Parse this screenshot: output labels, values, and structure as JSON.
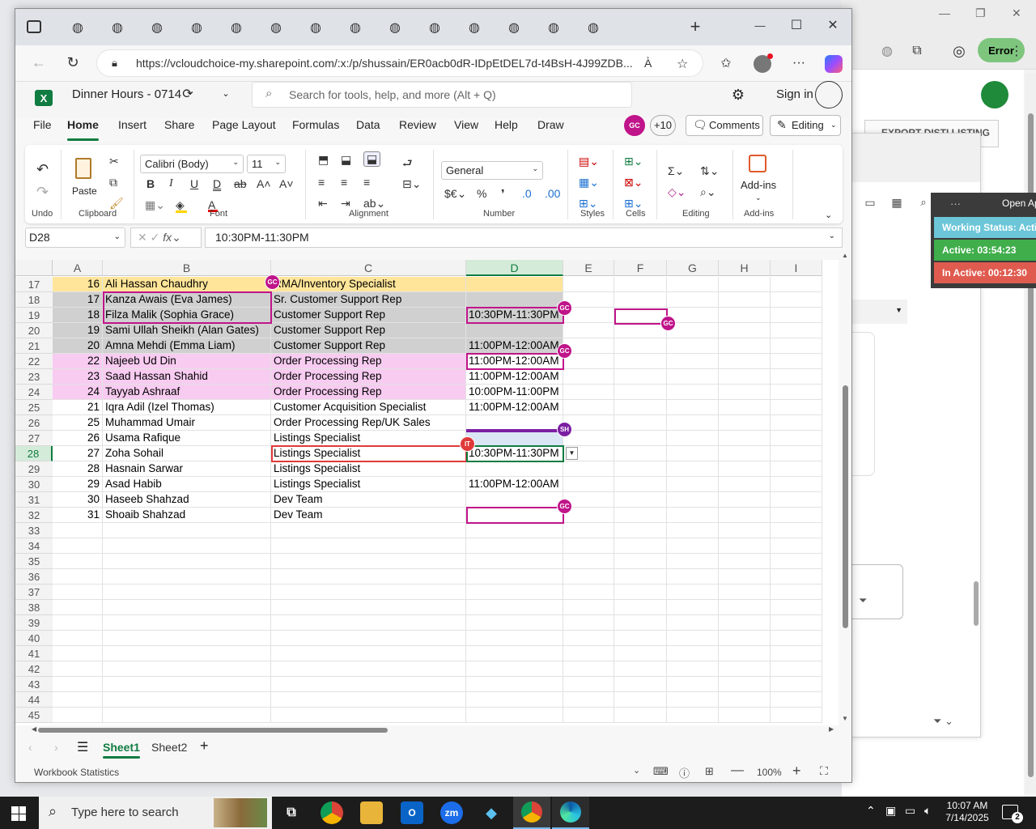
{
  "browser": {
    "url": "https://vcloudchoice-my.sharepoint.com/:x:/p/shussain/ER0acb0dR-IDpEtDEL7d-t4BsH-4J99ZDB...",
    "tab_count": 14
  },
  "bg": {
    "error_label": "Error",
    "export_label": "EXPORT DISTI LISTING",
    "status_header": "Open Ap",
    "working_status": "Working Status: Active",
    "active_time": "Active: 03:54:23",
    "inactive_time": "In Active: 00:12:30"
  },
  "excel": {
    "title": "Dinner Hours - 0714",
    "search_placeholder": "Search for tools, help, and more (Alt + Q)",
    "sign_in": "Sign in",
    "menu": [
      "File",
      "Home",
      "Insert",
      "Share",
      "Page Layout",
      "Formulas",
      "Data",
      "Review",
      "View",
      "Help",
      "Draw"
    ],
    "presence": {
      "avatar": "GC",
      "count": "+10"
    },
    "comments_label": "Comments",
    "editing_label": "Editing",
    "ribbon": {
      "undo_group": "Undo",
      "paste_label": "Paste",
      "clipboard_group": "Clipboard",
      "font_name": "Calibri (Body)",
      "font_size": "11",
      "font_group": "Font",
      "alignment_group": "Alignment",
      "number_format": "General",
      "number_group": "Number",
      "styles_group": "Styles",
      "cells_group": "Cells",
      "editing_group": "Editing",
      "addins_label": "Add-ins",
      "addins_group": "Add-ins"
    },
    "name_box": "D28",
    "formula": "10:30PM-11:30PM",
    "columns": [
      "A",
      "B",
      "C",
      "D",
      "E",
      "F",
      "G",
      "H",
      "I"
    ],
    "rows": [
      {
        "r": "17",
        "a": "16",
        "b": "Ali Hassan Chaudhry",
        "c": "RMA/Inventory Specialist",
        "d": "",
        "bg": "#ffe599"
      },
      {
        "r": "18",
        "a": "17",
        "b": "Kanza Awais (Eva James)",
        "c": "Sr. Customer Support Rep",
        "d": "",
        "bg": "#d0d0d0"
      },
      {
        "r": "19",
        "a": "18",
        "b": "Filza Malik (Sophia Grace)",
        "c": "Customer Support Rep",
        "d": "10:30PM-11:30PM",
        "bg": "#d0d0d0"
      },
      {
        "r": "20",
        "a": "19",
        "b": "Sami Ullah Sheikh (Alan Gates)",
        "c": "Customer Support Rep",
        "d": "",
        "bg": "#d0d0d0"
      },
      {
        "r": "21",
        "a": "20",
        "b": "Amna Mehdi (Emma Liam)",
        "c": "Customer Support Rep",
        "d": "11:00PM-12:00AM",
        "bg": "#d0d0d0"
      },
      {
        "r": "22",
        "a": "22",
        "b": "Najeeb Ud Din",
        "c": "Order Processing Rep",
        "d": "11:00PM-12:00AM",
        "bg": "#f8cbf1"
      },
      {
        "r": "23",
        "a": "23",
        "b": "Saad Hassan Shahid",
        "c": "Order Processing Rep",
        "d": "11:00PM-12:00AM",
        "bg": "#f8cbf1"
      },
      {
        "r": "24",
        "a": "24",
        "b": "Tayyab Ashraaf",
        "c": "Order Processing Rep",
        "d": "10:00PM-11:00PM",
        "bg": "#f8cbf1"
      },
      {
        "r": "25",
        "a": "21",
        "b": "Iqra Adil (Izel Thomas)",
        "c": "Customer Acquisition Specialist",
        "d": "11:00PM-12:00AM",
        "bg": "#ffffff"
      },
      {
        "r": "26",
        "a": "25",
        "b": "Muhammad Umair",
        "c": "Order Processing Rep/UK Sales",
        "d": "",
        "bg": "#ffffff"
      },
      {
        "r": "27",
        "a": "26",
        "b": "Usama Rafique",
        "c": "Listings Specialist",
        "d": "",
        "bg": "#ffffff"
      },
      {
        "r": "28",
        "a": "27",
        "b": "Zoha Sohail",
        "c": "Listings Specialist",
        "d": "10:30PM-11:30PM",
        "bg": "#ffffff"
      },
      {
        "r": "29",
        "a": "28",
        "b": "Hasnain Sarwar",
        "c": "Listings Specialist",
        "d": "",
        "bg": "#ffffff"
      },
      {
        "r": "30",
        "a": "29",
        "b": "Asad Habib",
        "c": "Listings Specialist",
        "d": "11:00PM-12:00AM",
        "bg": "#ffffff"
      },
      {
        "r": "31",
        "a": "30",
        "b": "Haseeb Shahzad",
        "c": "Dev Team",
        "d": "",
        "bg": "#ffffff"
      },
      {
        "r": "32",
        "a": "31",
        "b": "Shoaib Shahzad",
        "c": "Dev Team",
        "d": "",
        "bg": "#ffffff"
      }
    ],
    "empty_rows": [
      "33",
      "34",
      "35",
      "36",
      "37",
      "38",
      "39",
      "40",
      "41",
      "42",
      "43",
      "44",
      "45"
    ],
    "collaborators": [
      "GC",
      "GC",
      "GC",
      "GC",
      "SH",
      "IT",
      "GC"
    ],
    "sheets": [
      "Sheet1",
      "Sheet2"
    ],
    "status_left": "Workbook Statistics",
    "zoom": "100%"
  },
  "taskbar": {
    "search_placeholder": "Type here to search",
    "time": "10:07 AM",
    "date": "7/14/2025",
    "notification_count": "2"
  }
}
